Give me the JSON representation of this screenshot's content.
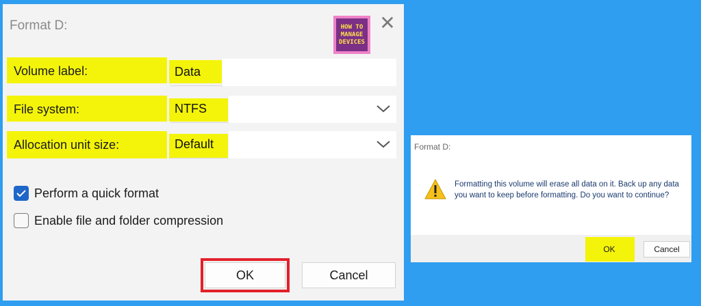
{
  "dialog": {
    "title": "Format D:",
    "logo_lines": [
      "HOW TO",
      "MANAGE",
      "DEVICES"
    ],
    "volume_label": {
      "label": "Volume label:",
      "value": "Data"
    },
    "file_system": {
      "label": "File system:",
      "value": "NTFS"
    },
    "allocation": {
      "label": "Allocation unit size:",
      "value": "Default"
    },
    "quick_format": {
      "label": "Perform a quick format",
      "checked": true
    },
    "compression": {
      "label": "Enable file and folder compression",
      "checked": false
    },
    "ok_label": "OK",
    "cancel_label": "Cancel"
  },
  "confirm": {
    "title": "Format D:",
    "message": "Formatting this volume will erase all data on it. Back up any data you want to keep before formatting. Do you want to continue?",
    "ok_label": "OK",
    "cancel_label": "Cancel"
  },
  "colors": {
    "background": "#2f9df0",
    "highlight": "#f4f40a",
    "ok_outline": "#e3202a",
    "checkbox_accent": "#1f66c9"
  }
}
